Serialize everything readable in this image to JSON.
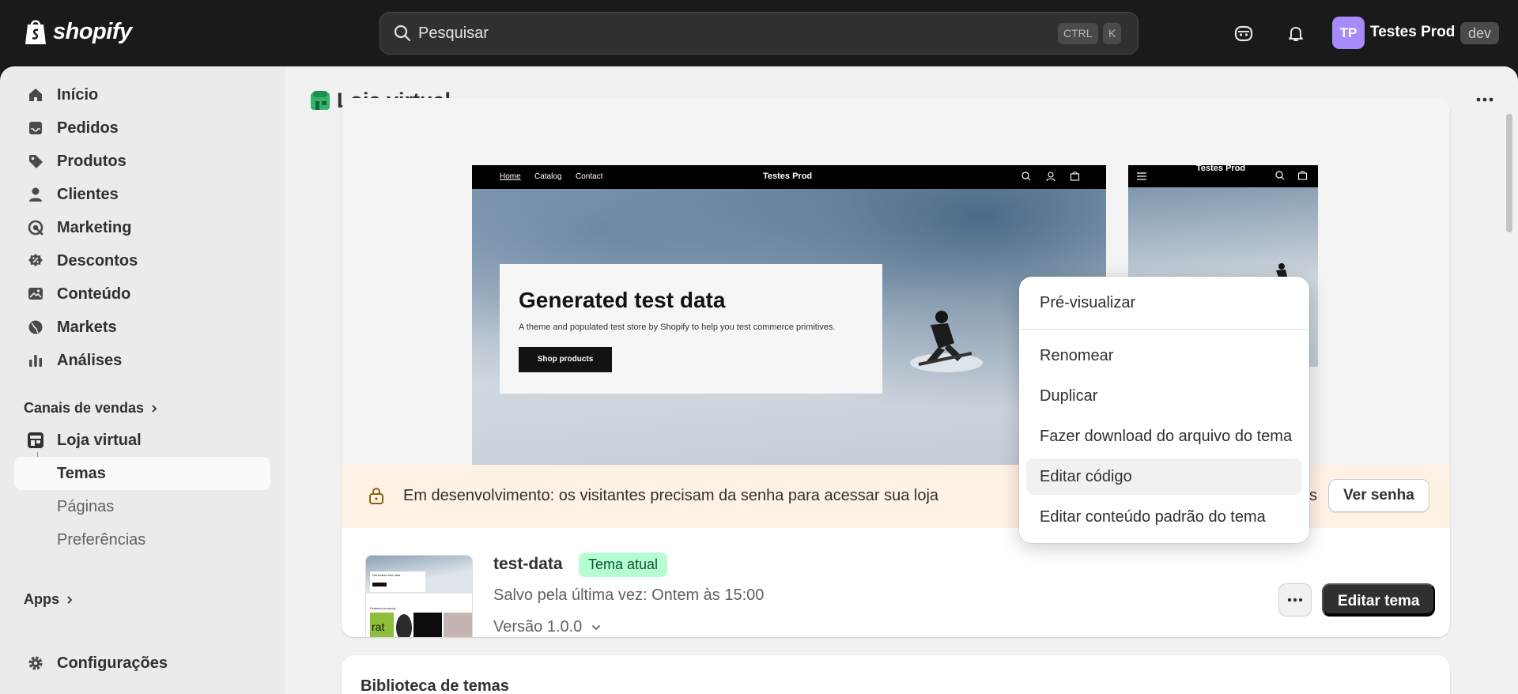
{
  "topbar": {
    "logo": "shopify",
    "search_placeholder": "Pesquisar",
    "kbd_ctrl": "CTRL",
    "kbd_k": "K",
    "avatar_initials": "TP",
    "store_name": "Testes Prod",
    "store_badge": "dev"
  },
  "sidebar": {
    "items": [
      {
        "label": "Início",
        "icon": "home-icon"
      },
      {
        "label": "Pedidos",
        "icon": "inbox-icon"
      },
      {
        "label": "Produtos",
        "icon": "tag-icon"
      },
      {
        "label": "Clientes",
        "icon": "person-icon"
      },
      {
        "label": "Marketing",
        "icon": "target-icon"
      },
      {
        "label": "Descontos",
        "icon": "discount-icon"
      },
      {
        "label": "Conteúdo",
        "icon": "image-icon"
      },
      {
        "label": "Markets",
        "icon": "globe-icon"
      },
      {
        "label": "Análises",
        "icon": "bar-chart-icon"
      }
    ],
    "sales_channels_label": "Canais de vendas",
    "online_store_label": "Loja virtual",
    "sub_items": [
      {
        "label": "Temas",
        "active": true
      },
      {
        "label": "Páginas",
        "active": false
      },
      {
        "label": "Preferências",
        "active": false
      }
    ],
    "apps_label": "Apps",
    "settings_label": "Configurações"
  },
  "page": {
    "title": "Loja virtual"
  },
  "preview": {
    "desktop_nav": [
      "Home",
      "Catalog",
      "Contact"
    ],
    "store_title": "Testes Prod",
    "hero_title": "Generated test data",
    "hero_subtitle": "A theme and populated test store by Shopify to help you test commerce primitives.",
    "hero_button": "Shop products"
  },
  "banner": {
    "text": "Em desenvolvimento: os visitantes precisam da senha para acessar sua loja",
    "partial": "s",
    "button": "Ver senha"
  },
  "theme": {
    "name": "test-data",
    "badge": "Tema atual",
    "saved": "Salvo pela última vez: Ontem às 15:00",
    "version": "Versão 1.0.0",
    "more_label": "•••",
    "edit_button": "Editar tema",
    "thumb_label": "Generated test data",
    "thumb_products": "Featured products",
    "thumb_word": "rat"
  },
  "library": {
    "title": "Biblioteca de temas"
  },
  "menu": {
    "items": [
      "Pré-visualizar",
      "Renomear",
      "Duplicar",
      "Fazer download do arquivo do tema",
      "Editar código",
      "Editar conteúdo padrão do tema"
    ],
    "hovered": "Editar código"
  },
  "colors": {
    "topbar": "#1a1a1a",
    "badge_green": "#b4fed2",
    "banner_bg": "#fff1e3",
    "primary_button": "#303030",
    "avatar": "#a78bfa"
  }
}
